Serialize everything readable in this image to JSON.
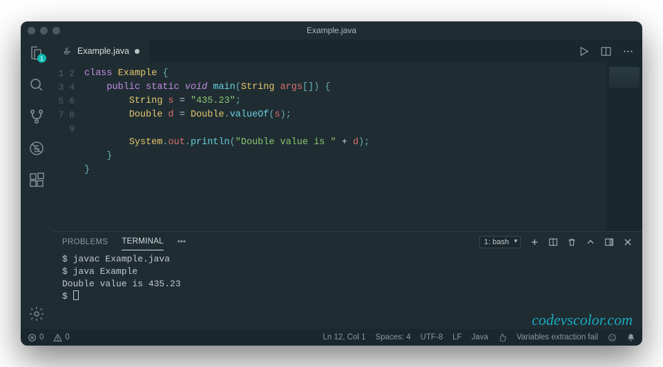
{
  "window": {
    "title": "Example.java"
  },
  "tab": {
    "filename": "Example.java"
  },
  "activity": {
    "badge": "1"
  },
  "code": {
    "lines": [
      "1",
      "2",
      "3",
      "4",
      "5",
      "6",
      "7",
      "8",
      "9"
    ],
    "l1": {
      "kw": "class",
      "cls": "Example",
      "brace": "{"
    },
    "l2": {
      "kw": "public static",
      "kw2": "void",
      "fn": "main",
      "p1": "(",
      "cls": "String",
      "var": "args",
      "br": "[]",
      "p2": ")",
      "brace": "{"
    },
    "l3": {
      "cls": "String",
      "var": "s",
      "eq": "=",
      "str": "\"435.23\"",
      "semi": ";"
    },
    "l4": {
      "cls": "Double",
      "var": "d",
      "eq": "=",
      "cls2": "Double",
      "dot": ".",
      "fn": "valueOf",
      "p1": "(",
      "arg": "s",
      "p2": ")",
      "semi": ";"
    },
    "l6": {
      "cls": "System",
      "dot": ".",
      "fld": "out",
      "dot2": ".",
      "fn": "println",
      "p1": "(",
      "str": "\"Double value is \"",
      "plus": "+",
      "var": "d",
      "p2": ")",
      "semi": ";"
    },
    "l7": {
      "brace": "}"
    },
    "l8": {
      "brace": "}"
    }
  },
  "panel": {
    "tabs": {
      "problems": "PROBLEMS",
      "terminal": "TERMINAL"
    },
    "terminal_select": "1: bash",
    "output": {
      "l1": "$ javac Example.java",
      "l2": "$ java Example",
      "l3": "Double value is 435.23",
      "l4": "$ "
    }
  },
  "watermark": "codevscolor.com",
  "status": {
    "errors": "0",
    "warnings": "0",
    "lncol": "Ln 12, Col 1",
    "spaces": "Spaces: 4",
    "encoding": "UTF-8",
    "eol": "LF",
    "lang": "Java",
    "msg": "Variables extraction fail"
  }
}
